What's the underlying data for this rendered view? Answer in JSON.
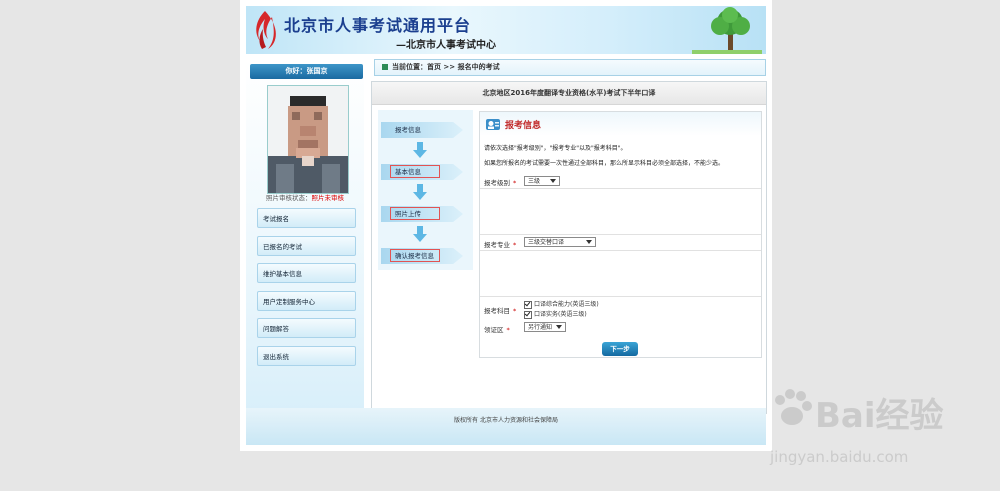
{
  "header": {
    "title": "北京市人事考试通用平台",
    "subtitle": "—北京市人事考试中心"
  },
  "sidebar": {
    "greeting": "你好：张国京",
    "photo_status_label": "照片审核状态：",
    "photo_status_value": "照片未审核",
    "menu": [
      {
        "label": "考试报名"
      },
      {
        "label": "已报名的考试"
      },
      {
        "label": "维护基本信息"
      },
      {
        "label": "用户定制服务中心"
      },
      {
        "label": "问题解答"
      },
      {
        "label": "退出系统"
      }
    ]
  },
  "breadcrumb": {
    "prefix": "当前位置：",
    "path": "首页 >> 报名中的考试"
  },
  "panel": {
    "title": "北京地区2016年度翻译专业资格(水平)考试下半年口译"
  },
  "steps": [
    {
      "label": "报考信息"
    },
    {
      "label": "基本信息"
    },
    {
      "label": "照片上传"
    },
    {
      "label": "确认报考信息"
    }
  ],
  "form": {
    "heading": "报考信息",
    "note1": "请依次选择\"报考级别\"，\"报考专业\"以及\"报考科目\"。",
    "note2": "如果您所报名的考试需要一次性通过全部科目，那么所显示科目必须全部选择，不能少选。",
    "level_label": "报考级别",
    "level_value": "三级",
    "major_label": "报考专业",
    "major_value": "三级交替口译",
    "subject_label": "报考科目",
    "subjects": [
      "口译综合能力(英语三级)",
      "口译实务(英语三级)"
    ],
    "region_label": "领证区",
    "region_value": "另行通知",
    "required_mark": "*",
    "next_label": "下一步"
  },
  "footer": {
    "copyright": "版权所有 北京市人力资源和社会保障局"
  },
  "watermark": {
    "brand": "Bai经验",
    "url": "jingyan.baidu.com"
  },
  "colors": {
    "accent_blue": "#1a6aa1",
    "title_red": "#c12a2a",
    "header_bg": "#bfe5f7"
  }
}
